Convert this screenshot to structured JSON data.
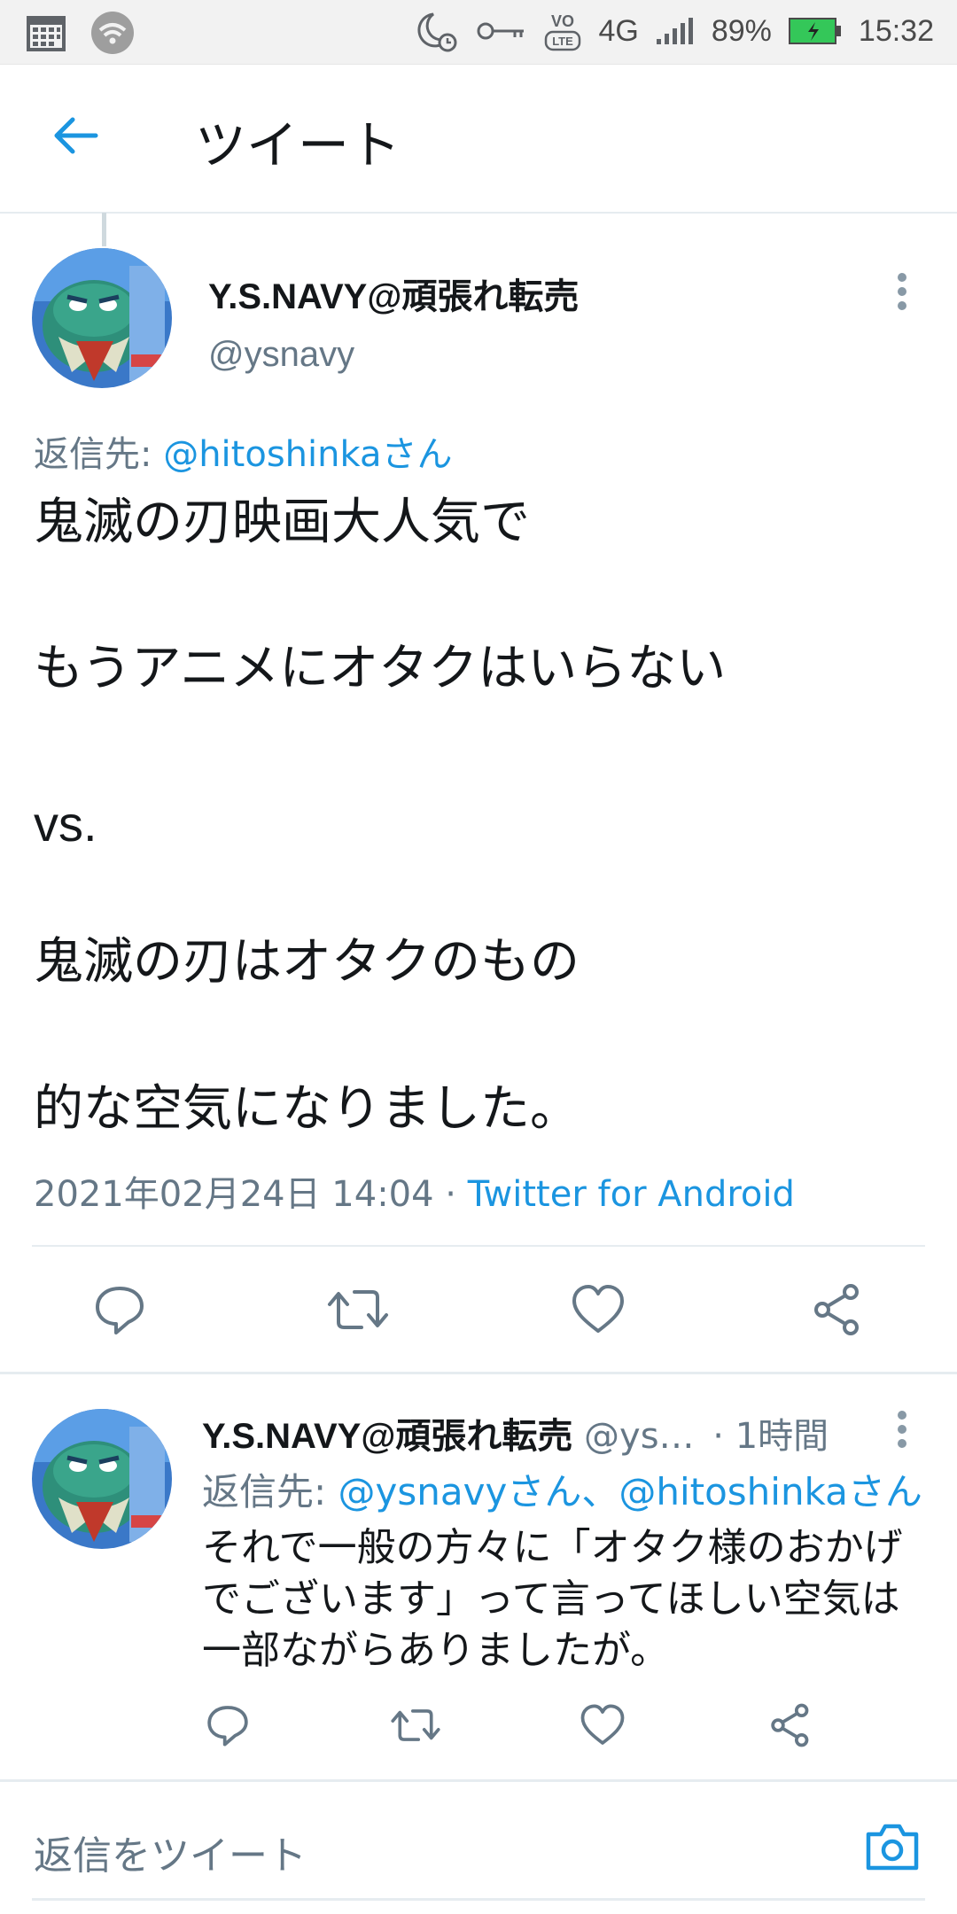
{
  "status_bar": {
    "battery": "89%",
    "time": "15:32",
    "network": "4G",
    "icons": [
      "calendar-icon",
      "wifi-icon",
      "moon-alarm-icon",
      "key-icon",
      "volte-icon",
      "signal-icon",
      "battery-icon"
    ]
  },
  "header": {
    "title": "ツイート"
  },
  "main_tweet": {
    "name": "Y.S.NAVY@頑張れ転売",
    "handle": "@ysnavy",
    "reply_prefix": "返信先:",
    "reply_to": "@hitoshinkaさん",
    "lines": [
      "鬼滅の刃映画大人気で",
      "もうアニメにオタクはいらない",
      "vs.",
      "鬼滅の刃はオタクのもの",
      "的な空気になりました。"
    ],
    "timestamp": "2021年02月24日 14:04 ·",
    "source": "Twitter for Android"
  },
  "reply_tweet": {
    "name": "Y.S.NAVY@頑張れ転売",
    "handle": "@ys…",
    "time": "· 1時間",
    "reply_prefix": "返信先:",
    "reply_to": "@ysnavyさん、@hitoshinkaさん",
    "lines": [
      "それで一般の方々に「オタク様のおかげ",
      "でございます」って言ってほしい空気は",
      "一部ながらありましたが。"
    ]
  },
  "compose": {
    "placeholder": "返信をツイート"
  },
  "colors": {
    "accent": "#1b95e0",
    "muted": "#657786",
    "icon": "#657786"
  }
}
